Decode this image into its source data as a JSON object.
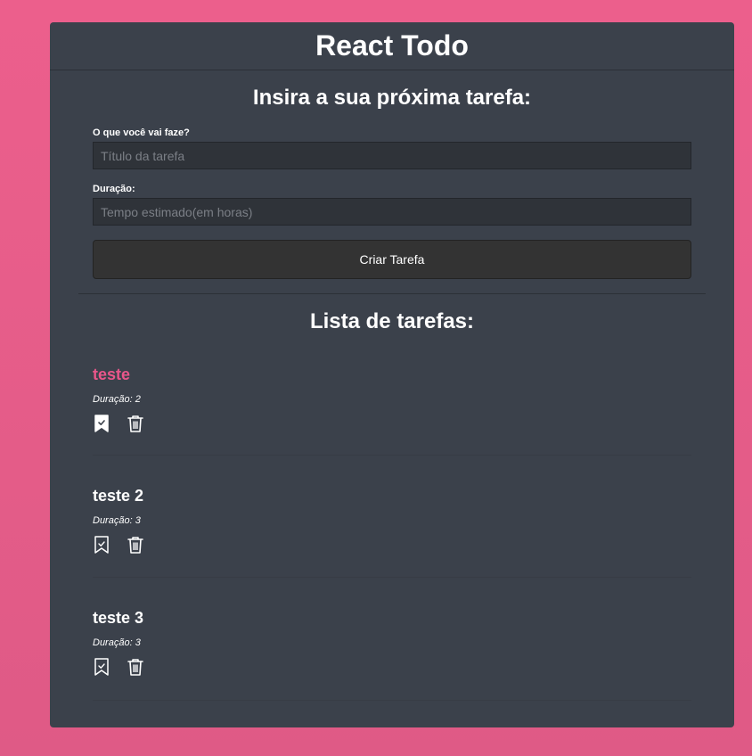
{
  "app": {
    "title": "React Todo"
  },
  "form": {
    "heading": "Insira a sua próxima tarefa:",
    "title_label": "O que você vai faze?",
    "title_placeholder": "Título da tarefa",
    "title_value": "",
    "duration_label": "Duração:",
    "duration_placeholder": "Tempo estimado(em horas)",
    "duration_value": "",
    "submit_label": "Criar Tarefa"
  },
  "list": {
    "heading": "Lista de tarefas:",
    "tasks": [
      {
        "title": "teste",
        "duration_text": "Duração: 2",
        "done": true,
        "complete_icon": "bookmark-check-filled-icon",
        "delete_icon": "trash-icon"
      },
      {
        "title": "teste 2",
        "duration_text": "Duração: 3",
        "done": false,
        "complete_icon": "bookmark-check-outline-icon",
        "delete_icon": "trash-icon"
      },
      {
        "title": "teste 3",
        "duration_text": "Duração: 3",
        "done": false,
        "complete_icon": "bookmark-check-outline-icon",
        "delete_icon": "trash-icon"
      }
    ]
  },
  "colors": {
    "background": "#ec5f8c",
    "panel": "#3b414b",
    "accent_done": "#e8568a",
    "button": "#333333",
    "input": "#2f3339"
  }
}
